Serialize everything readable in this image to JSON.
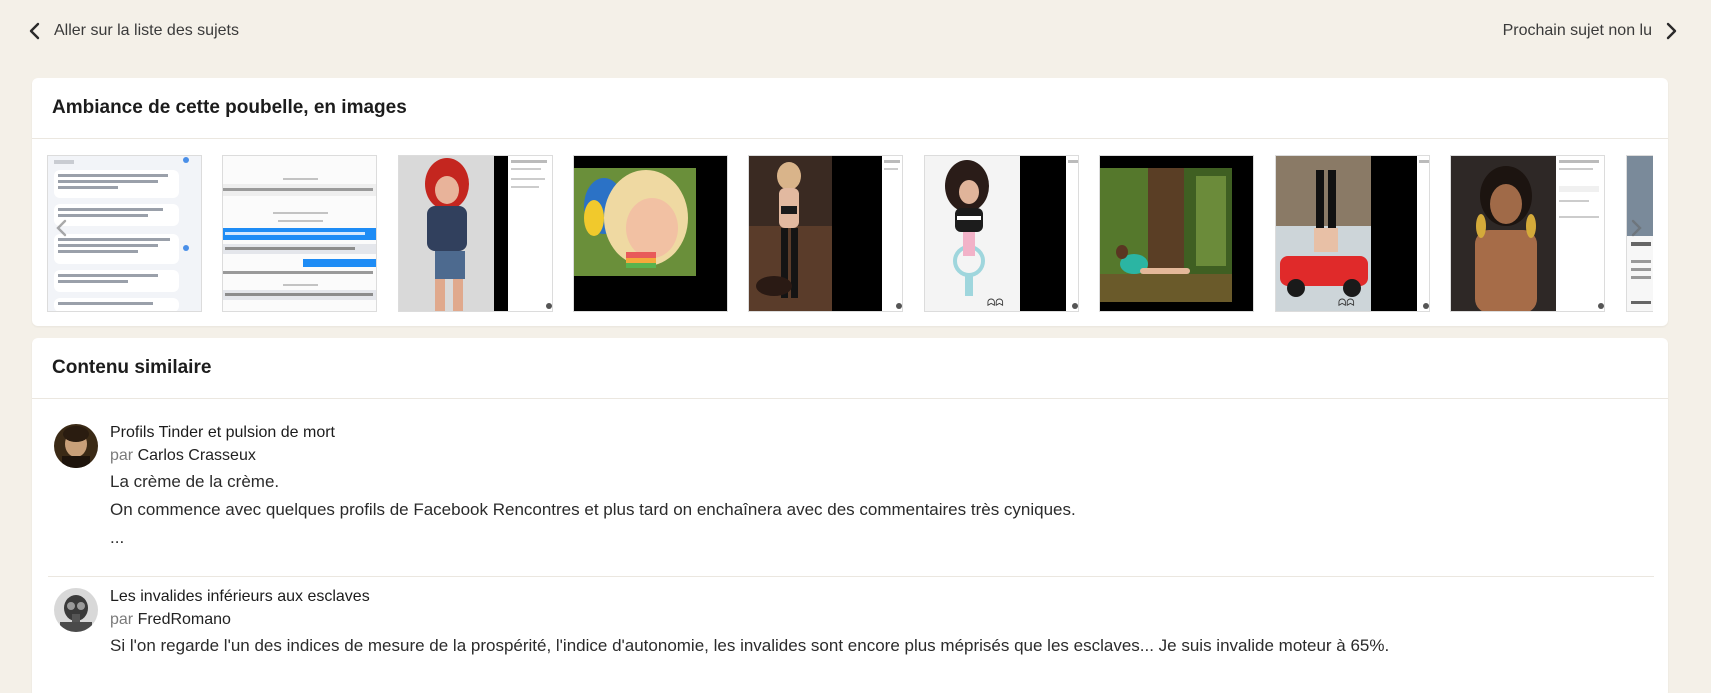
{
  "nav": {
    "back_label": "Aller sur la liste des sujets",
    "next_label": "Prochain sujet non lu"
  },
  "gallery": {
    "title": "Ambiance de cette poubelle, en images",
    "items": [
      {
        "kind": "screenshot-chat"
      },
      {
        "kind": "screenshot-messenger"
      },
      {
        "kind": "photo-redhead"
      },
      {
        "kind": "photo-blonde-parrot"
      },
      {
        "kind": "photo-lingerie"
      },
      {
        "kind": "photo-bicycle"
      },
      {
        "kind": "photo-forest"
      },
      {
        "kind": "photo-sportscar"
      },
      {
        "kind": "photo-portrait"
      },
      {
        "kind": "screenshot-partial"
      }
    ]
  },
  "similar": {
    "title": "Contenu similaire",
    "by_label": "par",
    "items": [
      {
        "title": "Profils Tinder et pulsion de mort",
        "author": "Carlos Crasseux",
        "lines": [
          "La crème de la crème.",
          "On commence avec quelques profils de Facebook Rencontres et plus tard on enchaînera avec des commentaires très cyniques.",
          "..."
        ]
      },
      {
        "title": "Les invalides inférieurs aux esclaves",
        "author": "FredRomano",
        "lines": [
          "Si l'on regarde l'un des indices de mesure de la prospérité, l'indice d'autonomie, les invalides sont encore plus méprisés que les esclaves... Je suis invalide moteur à 65%."
        ]
      }
    ]
  },
  "colors": {
    "page_bg": "#f4f0e8",
    "card_bg": "#ffffff",
    "messenger_blue": "#1e8cf5"
  }
}
